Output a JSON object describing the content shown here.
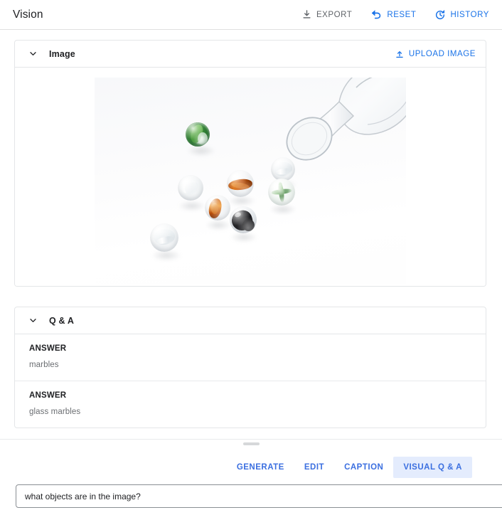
{
  "appbar": {
    "title": "Vision",
    "actions": [
      {
        "label": "EXPORT",
        "icon": "download-icon",
        "color": "#5f6368"
      },
      {
        "label": "RESET",
        "icon": "undo-icon",
        "color": "#1a73e8"
      },
      {
        "label": "HISTORY",
        "icon": "history-icon",
        "color": "#1a73e8"
      }
    ]
  },
  "image_card": {
    "title": "Image",
    "collapse_icon": "chevron-down-icon",
    "upload": {
      "label": "UPLOAD IMAGE",
      "icon": "upload-icon"
    },
    "photo_description": "Glass marbles scattered on a white surface beside a tipped-over clear glass goblet"
  },
  "qa_card": {
    "title": "Q & A",
    "collapse_icon": "chevron-down-icon",
    "items": [
      {
        "label": "ANSWER",
        "value": "marbles"
      },
      {
        "label": "ANSWER",
        "value": "glass marbles"
      }
    ]
  },
  "drawer": {
    "tabs": [
      {
        "label": "GENERATE",
        "active": false
      },
      {
        "label": "EDIT",
        "active": false
      },
      {
        "label": "CAPTION",
        "active": false
      },
      {
        "label": "VISUAL Q & A",
        "active": true
      }
    ],
    "input": {
      "value": "what objects are in the image?",
      "placeholder": "what objects are in the image?"
    }
  },
  "colors": {
    "accent_blue": "#1a73e8",
    "tab_blue": "#3b6fe0",
    "tab_active_bg": "#e4ecfd",
    "grey_text": "#5f6368",
    "border": "#e4e6e8"
  }
}
